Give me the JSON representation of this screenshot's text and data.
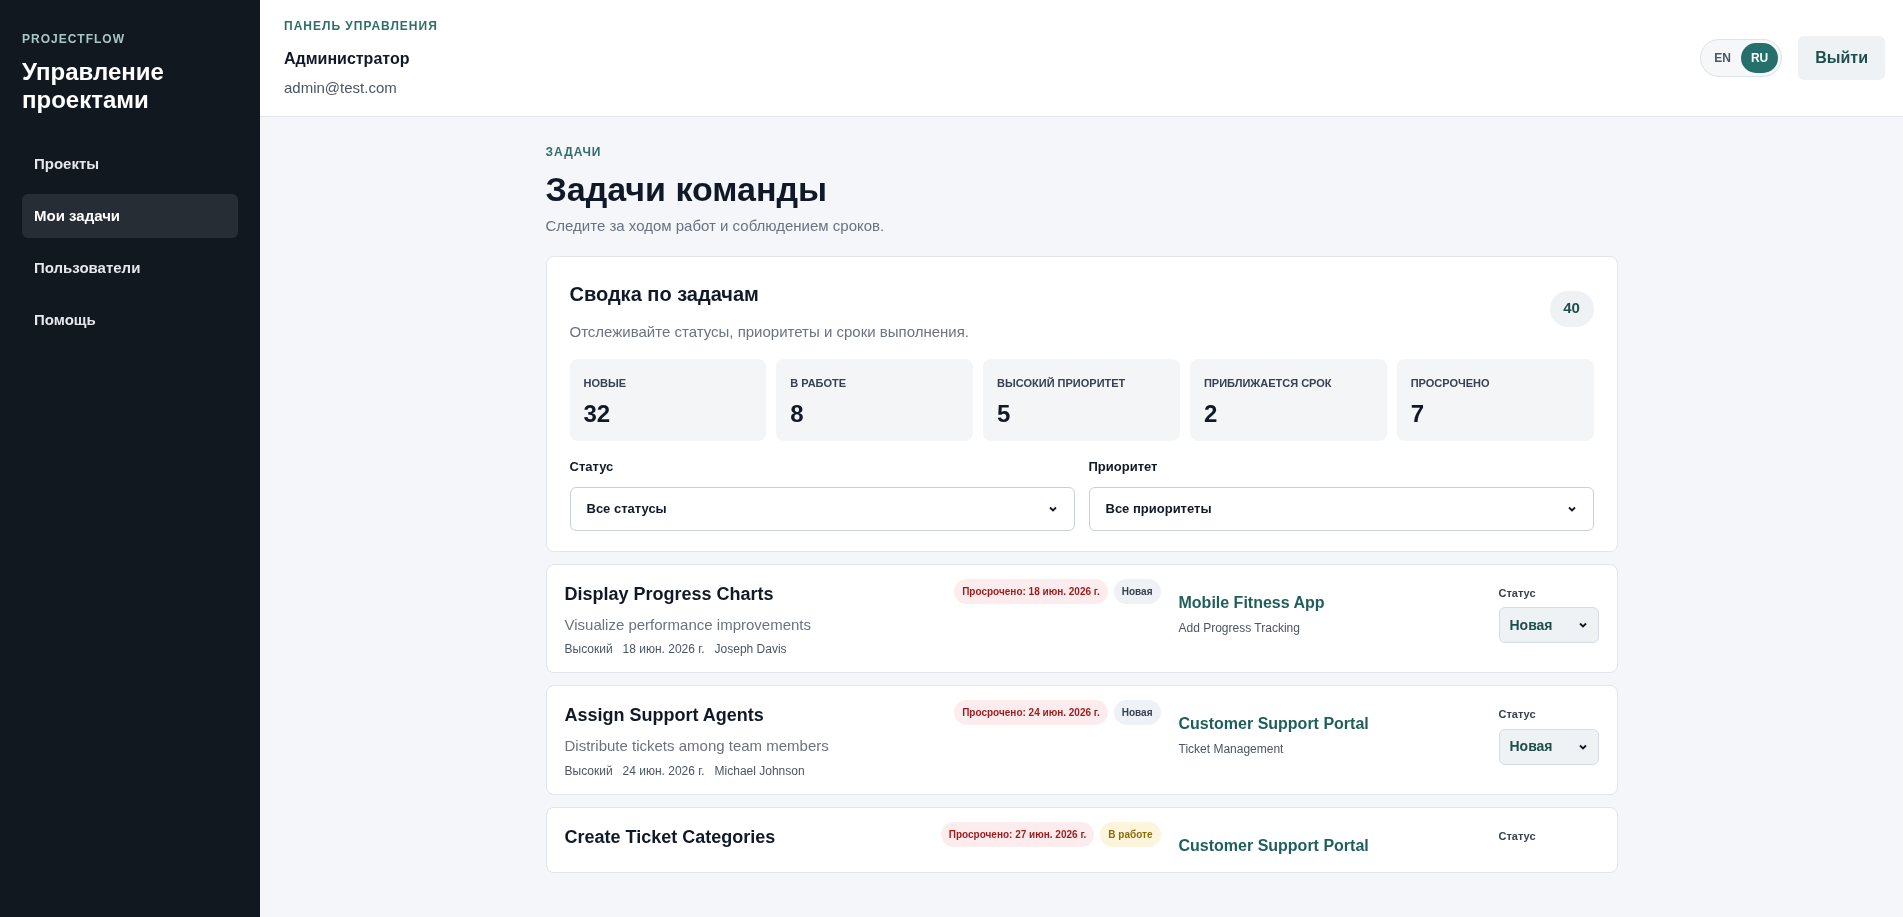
{
  "sidebar": {
    "brand": "PROJECTFLOW",
    "title": "Управление проектами",
    "items": [
      {
        "label": "Проекты",
        "selected": false
      },
      {
        "label": "Мои задачи",
        "selected": true
      },
      {
        "label": "Пользователи",
        "selected": false
      },
      {
        "label": "Помощь",
        "selected": false
      }
    ]
  },
  "header": {
    "eyebrow": "ПАНЕЛЬ УПРАВЛЕНИЯ",
    "user_name": "Администратор",
    "user_email": "admin@test.com",
    "languages": [
      {
        "label": "EN",
        "selected": false
      },
      {
        "label": "RU",
        "selected": true
      }
    ],
    "logout": "Выйти"
  },
  "page": {
    "eyebrow": "ЗАДАЧИ",
    "title": "Задачи команды",
    "subtitle": "Следите за ходом работ и соблюдением сроков."
  },
  "summary": {
    "title": "Сводка по задачам",
    "subtitle": "Отслеживайте статусы, приоритеты и сроки выполнения.",
    "total": "40",
    "stats": [
      {
        "label": "НОВЫЕ",
        "value": "32"
      },
      {
        "label": "В РАБОТЕ",
        "value": "8"
      },
      {
        "label": "ВЫСОКИЙ ПРИОРИТЕТ",
        "value": "5"
      },
      {
        "label": "ПРИБЛИЖАЕТСЯ СРОК",
        "value": "2"
      },
      {
        "label": "ПРОСРОЧЕНО",
        "value": "7"
      }
    ],
    "filters": [
      {
        "label": "Статус",
        "value": "Все статусы"
      },
      {
        "label": "Приоритет",
        "value": "Все приоритеты"
      }
    ]
  },
  "tasks": [
    {
      "title": "Display Progress Charts",
      "overdue": "Просрочено: 18 июн. 2026 г.",
      "status": {
        "label": "Новая",
        "kind": "new"
      },
      "description": "Visualize performance improvements",
      "priority": "Высокий",
      "due": "18 июн. 2026 г.",
      "assignee": "Joseph Davis",
      "project": "Mobile Fitness App",
      "feature": "Add Progress Tracking",
      "status_label": "Статус",
      "status_value": "Новая"
    },
    {
      "title": "Assign Support Agents",
      "overdue": "Просрочено: 24 июн. 2026 г.",
      "status": {
        "label": "Новая",
        "kind": "new"
      },
      "description": "Distribute tickets among team members",
      "priority": "Высокий",
      "due": "24 июн. 2026 г.",
      "assignee": "Michael Johnson",
      "project": "Customer Support Portal",
      "feature": "Ticket Management",
      "status_label": "Статус",
      "status_value": "Новая"
    },
    {
      "title": "Create Ticket Categories",
      "overdue": "Просрочено: 27 июн. 2026 г.",
      "status": {
        "label": "В работе",
        "kind": "in_progress"
      },
      "project": "Customer Support Portal",
      "status_label": "Статус"
    }
  ]
}
